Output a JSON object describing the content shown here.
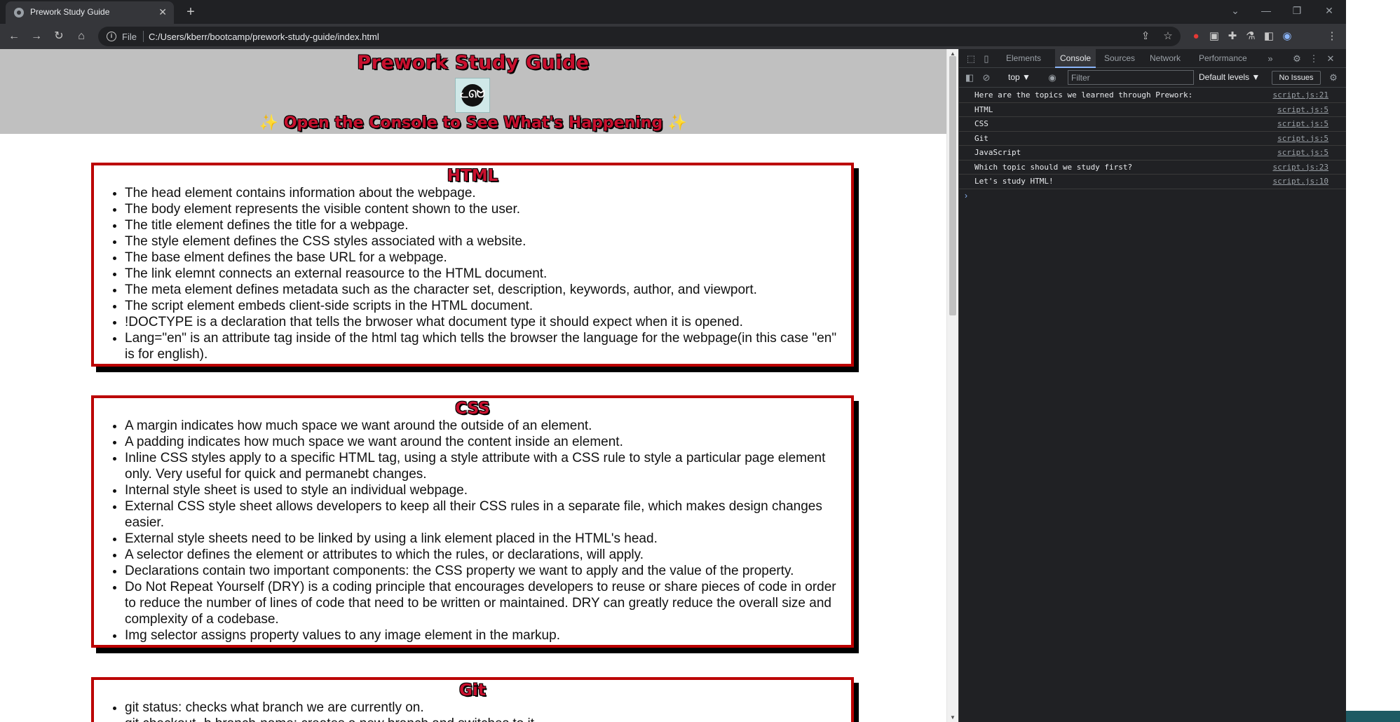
{
  "tab": {
    "title": "Prework Study Guide",
    "close": "✕",
    "new_tab": "+"
  },
  "window": {
    "minimize": "—",
    "restore": "❐",
    "close": "✕",
    "chevron": "⌄"
  },
  "toolbar": {
    "back": "←",
    "forward": "→",
    "reload": "↻",
    "home": "⌂",
    "scheme": "File",
    "url": "C:/Users/kberr/bootcamp/prework-study-guide/index.html"
  },
  "page": {
    "title": "Prework Study Guide",
    "subtitle_spark": "✨",
    "subtitle": "Open the Console to See What's Happening",
    "sections": [
      {
        "heading": "HTML",
        "items": [
          "The head element contains information about the webpage.",
          "The body element represents the visible content shown to the user.",
          "The title element defines the title for a webpage.",
          "The style element defines the CSS styles associated with a website.",
          "The base elment defines the base URL for a webpage.",
          "The link elemnt connects an external reasource to the HTML document.",
          "The meta element defines metadata such as the character set, description, keywords, author, and viewport.",
          "The script element embeds client-side scripts in the HTML document.",
          "!DOCTYPE is a declaration that tells the brwoser what document type it should expect when it is opened.",
          "Lang=\"en\" is an attribute tag inside of the html tag which tells the browser the language for the webpage(in this case \"en\" is for english)."
        ]
      },
      {
        "heading": "CSS",
        "items": [
          "A margin indicates how much space we want around the outside of an element.",
          "A padding indicates how much space we want around the content inside an element.",
          "Inline CSS styles apply to a specific HTML tag, using a style attribute with a CSS rule to style a particular page element only. Very useful for quick and permanebt changes.",
          "Internal style sheet is used to style an individual webpage.",
          "External CSS style sheet allows developers to keep all their CSS rules in a separate file, which makes design changes easier.",
          "External style sheets need to be linked by using a link element placed in the HTML's head.",
          "A selector defines the element or attributes to which the rules, or declarations, will apply.",
          "Declarations contain two important components: the CSS property we want to apply and the value of the property.",
          "Do Not Repeat Yourself (DRY) is a coding principle that encourages developers to reuse or share pieces of code in order to reduce the number of lines of code that need to be written or maintained. DRY can greatly reduce the overall size and complexity of a codebase.",
          "Img selector assigns property values to any image element in the markup."
        ]
      },
      {
        "heading": "Git",
        "items": [
          "git status: checks what branch we are currently on.",
          "git checkout -b branch-name: creates a new branch and switches to it."
        ]
      }
    ]
  },
  "devtools": {
    "tabs": [
      "Elements",
      "Console",
      "Sources",
      "Network",
      "Performance"
    ],
    "active_tab": "Console",
    "more": "»",
    "context": "top ▼",
    "filter_placeholder": "Filter",
    "levels": "Default levels ▼",
    "issues": "No Issues",
    "logs": [
      {
        "message": "Here are the topics we learned through Prework:",
        "source": "script.js:21"
      },
      {
        "message": "HTML",
        "source": "script.js:5"
      },
      {
        "message": "CSS",
        "source": "script.js:5"
      },
      {
        "message": "Git",
        "source": "script.js:5"
      },
      {
        "message": "JavaScript",
        "source": "script.js:5"
      },
      {
        "message": "Which topic should we study first?",
        "source": "script.js:23"
      },
      {
        "message": "Let's study HTML!",
        "source": "script.js:10"
      }
    ],
    "prompt": "›"
  },
  "colors": {
    "accent": "#c8102e",
    "border": "#bb0000",
    "header_bg": "#c0c0c0",
    "devtools_bg": "#202124"
  }
}
